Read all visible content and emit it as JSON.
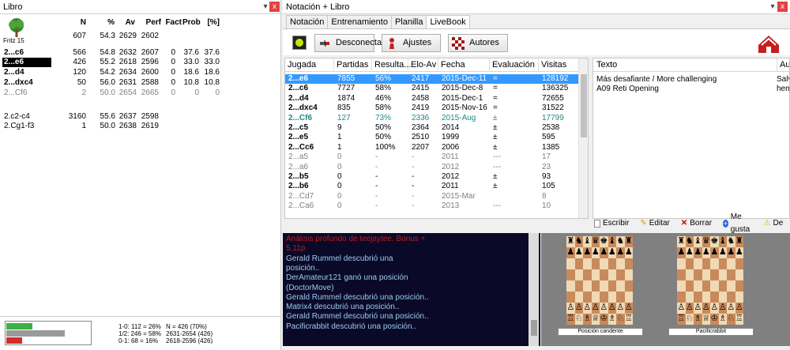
{
  "left_pane": {
    "title": "Libro",
    "pin_icon": "pin-icon",
    "close_label": "x",
    "headers": {
      "n": "N",
      "pct": "%",
      "av": "Av",
      "perf": "Perf",
      "fact": "Fact",
      "prob": "Prob",
      "pctb": "[%]"
    },
    "engine_label": "Fritz 15",
    "root": {
      "n": "607",
      "pct": "54.3",
      "av": "2629",
      "perf": "2602"
    },
    "rows": [
      {
        "mv": "2...c6",
        "n": "566",
        "pct": "54.8",
        "av": "2632",
        "perf": "2607",
        "fact": "0",
        "prob": "37.6",
        "pctb": "37.6",
        "style": "bold"
      },
      {
        "mv": "2...e6",
        "n": "426",
        "pct": "55.2",
        "av": "2618",
        "perf": "2596",
        "fact": "0",
        "prob": "33.0",
        "pctb": "33.0",
        "style": "selected"
      },
      {
        "mv": "2...d4",
        "n": "120",
        "pct": "54.2",
        "av": "2634",
        "perf": "2600",
        "fact": "0",
        "prob": "18.6",
        "pctb": "18.6",
        "style": "bold"
      },
      {
        "mv": "2...dxc4",
        "n": "50",
        "pct": "56.0",
        "av": "2631",
        "perf": "2588",
        "fact": "0",
        "prob": "10.8",
        "pctb": "10.8",
        "style": "bold"
      },
      {
        "mv": "2...Cf6",
        "n": "2",
        "pct": "50.0",
        "av": "2654",
        "perf": "2665",
        "fact": "0",
        "prob": "0",
        "pctb": "0",
        "style": "gray"
      }
    ],
    "alt_rows": [
      {
        "mv": "2.c2-c4",
        "n": "3160",
        "pct": "55.6",
        "av": "2637",
        "perf": "2598"
      },
      {
        "mv": "2.Cg1-f3",
        "n": "1",
        "pct": "50.0",
        "av": "2638",
        "perf": "2619"
      }
    ],
    "progress": {
      "white": 0.26,
      "draw": 0.58,
      "black": 0.16
    },
    "stats": {
      "w": "1-0: 112 = 26%",
      "d": "1/2: 246 = 58%",
      "b": "0-1: 68 = 16%",
      "n": "N = 426 (70%)",
      "r1": "2631-2654 (426)",
      "r2": "2618-2596 (426)"
    }
  },
  "right_pane": {
    "title": "Notación + Libro",
    "tabs": [
      "Notación",
      "Entrenamiento",
      "Planilla",
      "LiveBook"
    ],
    "active_tab": 3,
    "toolbar": {
      "disconnect": "Desconectar",
      "settings": "Ajustes",
      "authors": "Autores"
    },
    "grid_headers": [
      "Jugada",
      "Partidas",
      "Resulta...",
      "Elo-Av",
      "Fecha",
      "Evaluación",
      "Visitas"
    ],
    "grid_rows": [
      {
        "jg": "2...e6",
        "p": "7855",
        "r": "56%",
        "e": "2417",
        "f": "2015-Dec-11",
        "ev": "=",
        "v": "128192",
        "style": "selected"
      },
      {
        "jg": "2...c6",
        "p": "7727",
        "r": "58%",
        "e": "2415",
        "f": "2015-Dec-8",
        "ev": "=",
        "v": "136325",
        "style": "bold"
      },
      {
        "jg": "2...d4",
        "p": "1874",
        "r": "46%",
        "e": "2458",
        "f": "2015-Dec-1",
        "ev": "=",
        "v": "72655",
        "style": "bold"
      },
      {
        "jg": "2...dxc4",
        "p": "835",
        "r": "58%",
        "e": "2419",
        "f": "2015-Nov-16",
        "ev": "=",
        "v": "31522",
        "style": "bold"
      },
      {
        "jg": "2...Cf6",
        "p": "127",
        "r": "73%",
        "e": "2336",
        "f": "2015-Aug",
        "ev": "±",
        "v": "17799",
        "style": "teal"
      },
      {
        "jg": "2...c5",
        "p": "9",
        "r": "50%",
        "e": "2364",
        "f": "2014",
        "ev": "±",
        "v": "2538",
        "style": "bold"
      },
      {
        "jg": "2...e5",
        "p": "1",
        "r": "50%",
        "e": "2510",
        "f": "1999",
        "ev": "±",
        "v": "595",
        "style": "bold"
      },
      {
        "jg": "2...Cc6",
        "p": "1",
        "r": "100%",
        "e": "2207",
        "f": "2006",
        "ev": "±",
        "v": "1385",
        "style": "bold"
      },
      {
        "jg": "2...a5",
        "p": "0",
        "r": "-",
        "e": "-",
        "f": "2011",
        "ev": "---",
        "v": "17",
        "style": "gray"
      },
      {
        "jg": "2...a6",
        "p": "0",
        "r": "-",
        "e": "-",
        "f": "2012",
        "ev": "---",
        "v": "23",
        "style": "gray"
      },
      {
        "jg": "2...b5",
        "p": "0",
        "r": "-",
        "e": "-",
        "f": "2012",
        "ev": "±",
        "v": "93",
        "style": "bold"
      },
      {
        "jg": "2...b6",
        "p": "0",
        "r": "-",
        "e": "-",
        "f": "2011",
        "ev": "±",
        "v": "105",
        "style": "bold"
      },
      {
        "jg": "2...Cd7",
        "p": "0",
        "r": "-",
        "e": "-",
        "f": "2015-Mar",
        "ev": "",
        "v": "8",
        "style": "gray"
      },
      {
        "jg": "2...Ca6",
        "p": "0",
        "r": "-",
        "e": "-",
        "f": "2013",
        "ev": "---",
        "v": "10",
        "style": "gray"
      }
    ],
    "comment_headers": {
      "texto": "Texto",
      "autor": "Autor"
    },
    "comments": [
      {
        "texto": "Más desafiante / More challenging",
        "autor": "Salva"
      },
      {
        "texto": "A09 Reti Opening",
        "autor": "hem"
      }
    ],
    "comment_actions": [
      "Escribir",
      "Editar",
      "Borrar",
      "Me gusta",
      "De"
    ],
    "chat": [
      {
        "text": "Análisis profundo de teejaytee. Bonus +",
        "style": "red"
      },
      {
        "text": "5.11p",
        "style": "red"
      },
      {
        "text": "Gerald Rummel descubrió una",
        "style": "blue"
      },
      {
        "text": "posición..",
        "style": "blue"
      },
      {
        "text": "DerAmateur121 ganó una posición",
        "style": "blue"
      },
      {
        "text": "(DoctorMove)",
        "style": "blue"
      },
      {
        "text": "Gerald Rummel descubrió una posición..",
        "style": "blue"
      },
      {
        "text": "Matrix4 descubrió una posición..",
        "style": "blue"
      },
      {
        "text": "Gerald Rummel descubrió una posición..",
        "style": "blue"
      },
      {
        "text": "Pacificrabbit descubrió una posición..",
        "style": "blue"
      }
    ],
    "boards": {
      "left_label": "Posición candente",
      "right_label": "Pacificrabbit"
    }
  },
  "colors": {
    "selection": "#3399ff",
    "chat_bg": "#0a0a28",
    "chat_text": "#9ccbf0",
    "chat_red": "#c21b1b",
    "win": "#3cb043",
    "draw": "#9a9a9a",
    "loss": "#d42b2b"
  }
}
